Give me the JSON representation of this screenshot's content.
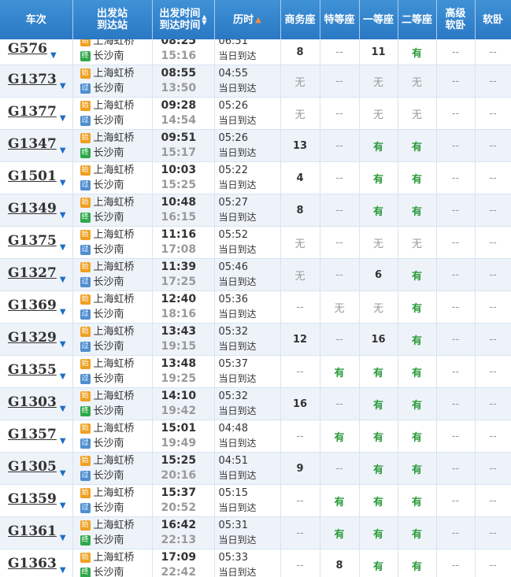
{
  "header": {
    "train_no": "车次",
    "station_1": "出发站",
    "station_2": "到达站",
    "time_1": "出发时间",
    "time_2": "到达时间",
    "duration": "历时",
    "business": "商务座",
    "premium": "特等座",
    "first": "一等座",
    "second": "二等座",
    "soft_sleeper_1": "高级",
    "soft_sleeper_2": "软卧",
    "soft_berth": "软卧"
  },
  "icons": {
    "sort_desc": "▲▼",
    "sort_asc": "▲",
    "expand": "▼"
  },
  "colors": {
    "header_bg": "#2a78c4",
    "available": "#2a9a3a",
    "start_badge": "#f0a020",
    "end_badge": "#2fa84a",
    "pass_badge": "#4f8ed0"
  },
  "rows": [
    {
      "train": "G576",
      "from_badge": "始",
      "from": "上海虹桥",
      "to_badge": "终",
      "to": "长沙南",
      "dep": "08:25",
      "arr": "15:16",
      "duration": "06:51",
      "arrive_day": "当日到达",
      "business": "8",
      "premium": "--",
      "first": "11",
      "second": "有",
      "high_soft": "--",
      "soft": "--"
    },
    {
      "train": "G1373",
      "from_badge": "始",
      "from": "上海虹桥",
      "to_badge": "过",
      "to": "长沙南",
      "dep": "08:55",
      "arr": "13:50",
      "duration": "04:55",
      "arrive_day": "当日到达",
      "business": "无",
      "premium": "--",
      "first": "无",
      "second": "无",
      "high_soft": "--",
      "soft": "--"
    },
    {
      "train": "G1377",
      "from_badge": "始",
      "from": "上海虹桥",
      "to_badge": "过",
      "to": "长沙南",
      "dep": "09:28",
      "arr": "14:54",
      "duration": "05:26",
      "arrive_day": "当日到达",
      "business": "无",
      "premium": "--",
      "first": "无",
      "second": "无",
      "high_soft": "--",
      "soft": "--"
    },
    {
      "train": "G1347",
      "from_badge": "始",
      "from": "上海虹桥",
      "to_badge": "终",
      "to": "长沙南",
      "dep": "09:51",
      "arr": "15:17",
      "duration": "05:26",
      "arrive_day": "当日到达",
      "business": "13",
      "premium": "--",
      "first": "有",
      "second": "有",
      "high_soft": "--",
      "soft": "--"
    },
    {
      "train": "G1501",
      "from_badge": "始",
      "from": "上海虹桥",
      "to_badge": "过",
      "to": "长沙南",
      "dep": "10:03",
      "arr": "15:25",
      "duration": "05:22",
      "arrive_day": "当日到达",
      "business": "4",
      "premium": "--",
      "first": "有",
      "second": "有",
      "high_soft": "--",
      "soft": "--"
    },
    {
      "train": "G1349",
      "from_badge": "始",
      "from": "上海虹桥",
      "to_badge": "终",
      "to": "长沙南",
      "dep": "10:48",
      "arr": "16:15",
      "duration": "05:27",
      "arrive_day": "当日到达",
      "business": "8",
      "premium": "--",
      "first": "有",
      "second": "有",
      "high_soft": "--",
      "soft": "--"
    },
    {
      "train": "G1375",
      "from_badge": "始",
      "from": "上海虹桥",
      "to_badge": "过",
      "to": "长沙南",
      "dep": "11:16",
      "arr": "17:08",
      "duration": "05:52",
      "arrive_day": "当日到达",
      "business": "无",
      "premium": "--",
      "first": "无",
      "second": "无",
      "high_soft": "--",
      "soft": "--"
    },
    {
      "train": "G1327",
      "from_badge": "始",
      "from": "上海虹桥",
      "to_badge": "过",
      "to": "长沙南",
      "dep": "11:39",
      "arr": "17:25",
      "duration": "05:46",
      "arrive_day": "当日到达",
      "business": "无",
      "premium": "--",
      "first": "6",
      "second": "有",
      "high_soft": "--",
      "soft": "--"
    },
    {
      "train": "G1369",
      "from_badge": "始",
      "from": "上海虹桥",
      "to_badge": "过",
      "to": "长沙南",
      "dep": "12:40",
      "arr": "18:16",
      "duration": "05:36",
      "arrive_day": "当日到达",
      "business": "--",
      "premium": "无",
      "first": "无",
      "second": "有",
      "high_soft": "--",
      "soft": "--"
    },
    {
      "train": "G1329",
      "from_badge": "始",
      "from": "上海虹桥",
      "to_badge": "过",
      "to": "长沙南",
      "dep": "13:43",
      "arr": "19:15",
      "duration": "05:32",
      "arrive_day": "当日到达",
      "business": "12",
      "premium": "--",
      "first": "16",
      "second": "有",
      "high_soft": "--",
      "soft": "--"
    },
    {
      "train": "G1355",
      "from_badge": "始",
      "from": "上海虹桥",
      "to_badge": "过",
      "to": "长沙南",
      "dep": "13:48",
      "arr": "19:25",
      "duration": "05:37",
      "arrive_day": "当日到达",
      "business": "--",
      "premium": "有",
      "first": "有",
      "second": "有",
      "high_soft": "--",
      "soft": "--"
    },
    {
      "train": "G1303",
      "from_badge": "始",
      "from": "上海虹桥",
      "to_badge": "终",
      "to": "长沙南",
      "dep": "14:10",
      "arr": "19:42",
      "duration": "05:32",
      "arrive_day": "当日到达",
      "business": "16",
      "premium": "--",
      "first": "有",
      "second": "有",
      "high_soft": "--",
      "soft": "--"
    },
    {
      "train": "G1357",
      "from_badge": "始",
      "from": "上海虹桥",
      "to_badge": "过",
      "to": "长沙南",
      "dep": "15:01",
      "arr": "19:49",
      "duration": "04:48",
      "arrive_day": "当日到达",
      "business": "--",
      "premium": "有",
      "first": "有",
      "second": "有",
      "high_soft": "--",
      "soft": "--"
    },
    {
      "train": "G1305",
      "from_badge": "始",
      "from": "上海虹桥",
      "to_badge": "过",
      "to": "长沙南",
      "dep": "15:25",
      "arr": "20:16",
      "duration": "04:51",
      "arrive_day": "当日到达",
      "business": "9",
      "premium": "--",
      "first": "有",
      "second": "有",
      "high_soft": "--",
      "soft": "--"
    },
    {
      "train": "G1359",
      "from_badge": "始",
      "from": "上海虹桥",
      "to_badge": "过",
      "to": "长沙南",
      "dep": "15:37",
      "arr": "20:52",
      "duration": "05:15",
      "arrive_day": "当日到达",
      "business": "--",
      "premium": "有",
      "first": "有",
      "second": "有",
      "high_soft": "--",
      "soft": "--"
    },
    {
      "train": "G1361",
      "from_badge": "始",
      "from": "上海虹桥",
      "to_badge": "终",
      "to": "长沙南",
      "dep": "16:42",
      "arr": "22:13",
      "duration": "05:31",
      "arrive_day": "当日到达",
      "business": "--",
      "premium": "有",
      "first": "有",
      "second": "有",
      "high_soft": "--",
      "soft": "--"
    },
    {
      "train": "G1363",
      "from_badge": "始",
      "from": "上海虹桥",
      "to_badge": "终",
      "to": "长沙南",
      "dep": "17:09",
      "arr": "22:42",
      "duration": "05:33",
      "arrive_day": "当日到达",
      "business": "--",
      "premium": "8",
      "first": "有",
      "second": "有",
      "high_soft": "--",
      "soft": "--"
    }
  ]
}
